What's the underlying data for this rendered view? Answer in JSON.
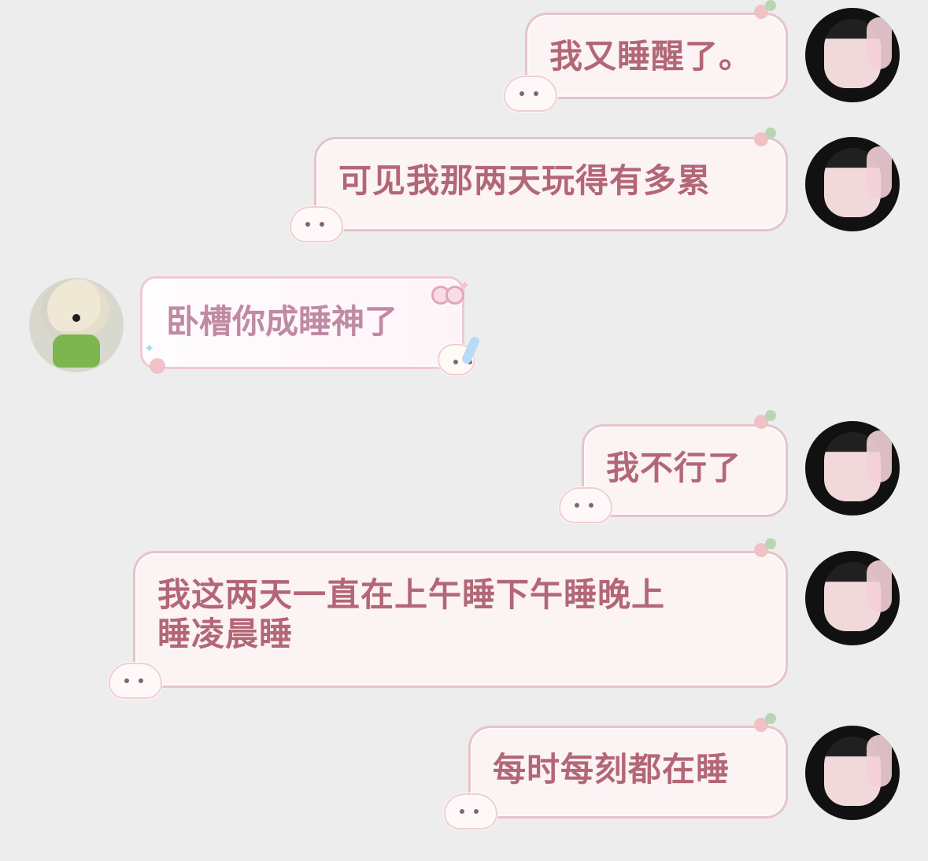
{
  "messages": [
    {
      "sender": "me",
      "text": "我又睡醒了。"
    },
    {
      "sender": "me",
      "text": "可见我那两天玩得有多累"
    },
    {
      "sender": "friend",
      "text": "卧槽你成睡神了"
    },
    {
      "sender": "me",
      "text": "我不行了"
    },
    {
      "sender": "me",
      "text": "我这两天一直在上午睡下午睡晚上\n睡凌晨睡"
    },
    {
      "sender": "me",
      "text": "每时每刻都在睡"
    }
  ],
  "avatars": {
    "me": "girl-avatar",
    "friend": "lamb-plush-avatar"
  },
  "colors": {
    "background": "#ededed",
    "outgoing_text": "#b36776",
    "incoming_text": "#c08aa4",
    "bubble_border": "#e6c4c8"
  }
}
